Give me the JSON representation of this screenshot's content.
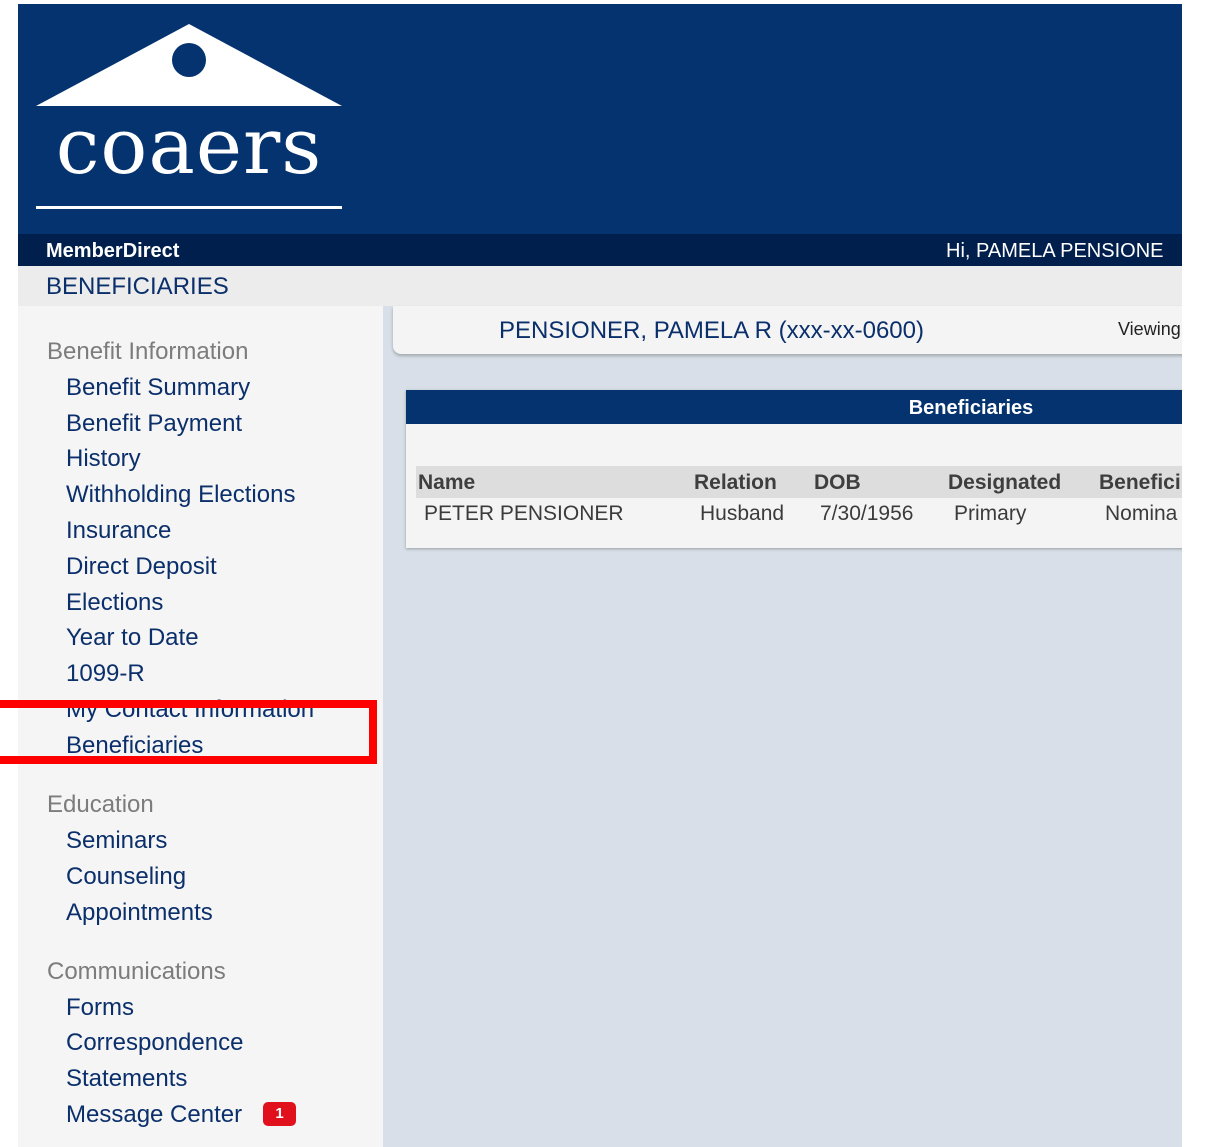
{
  "brand": {
    "logo_text": "coaers"
  },
  "topbar": {
    "product_name": "MemberDirect",
    "greeting": "Hi, PAMELA PENSIONE"
  },
  "page": {
    "title": "BENEFICIARIES"
  },
  "member": {
    "name_ssn": "PENSIONER, PAMELA R (xxx-xx-0600)",
    "viewing": "Viewing"
  },
  "sidebar": {
    "groups": [
      {
        "label": "Benefit Information",
        "items": [
          "Benefit Summary",
          "Benefit Payment",
          "History",
          "Withholding Elections",
          "Insurance",
          "Direct Deposit",
          "Elections",
          "Year to Date",
          "1099-R",
          "My Contact Information",
          "Beneficiaries"
        ]
      },
      {
        "label": "Education",
        "items": [
          "Seminars",
          "Counseling",
          "Appointments"
        ]
      },
      {
        "label": "Communications",
        "items": [
          "Forms",
          "Correspondence",
          "Statements",
          "Message Center"
        ]
      }
    ],
    "message_badge": "1",
    "selected": "Beneficiaries"
  },
  "beneficiaries": {
    "panel_title": "Beneficiaries",
    "columns": [
      "Name",
      "Relation",
      "DOB",
      "Designated",
      "Benefici"
    ],
    "rows": [
      [
        "PETER PENSIONER",
        "Husband",
        "7/30/1956",
        "Primary",
        "Nomina"
      ]
    ]
  },
  "colors": {
    "brand_navy": "#05336f",
    "topbar_dark": "#001f4c",
    "link": "#0b2f6b",
    "badge_red": "#e0101d",
    "highlight_red": "#ff0000"
  }
}
